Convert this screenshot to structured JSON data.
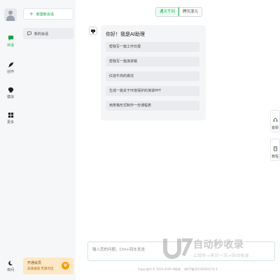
{
  "rail": {
    "items": [
      {
        "label": "对话",
        "icon": "chat-icon"
      },
      {
        "label": "创作",
        "icon": "feather-icon"
      },
      {
        "label": "模拟",
        "icon": "head-profile-icon"
      },
      {
        "label": "更多",
        "icon": "grid-icon"
      }
    ],
    "night_label": "夜间"
  },
  "panel": {
    "new_chat_label": "新建新会话",
    "conversation_label": "新的会话",
    "vip_title": "开通会员",
    "vip_subtitle": "高速通道 无限对话"
  },
  "tabs": [
    {
      "label": "通义千问",
      "active": true
    },
    {
      "label": "腾讯混元",
      "active": false
    }
  ],
  "welcome": {
    "greeting": "你好！我是AI助理",
    "suggestions": [
      "帮我写一篇工作日报",
      "帮我写一篇演讲稿",
      "红烧牛肉的做法",
      "生成一篇关于环境保护的演讲PPT",
      "用表格形式制作一份课程表"
    ]
  },
  "side_buttons": [
    {
      "label": "客服",
      "icon": "headset-icon"
    },
    {
      "label": "教程",
      "icon": "book-icon"
    }
  ],
  "input": {
    "placeholder": "输入您的问题，Ctrl+回车发送"
  },
  "footer": {
    "copyright": "Copyright © 2024-2026 AI助理　 皖ICP备2023020417号-1"
  },
  "watermark": {
    "text_main": "自动秒收录",
    "text_sub": "上线秒→来访一次→自动收录"
  },
  "colors": {
    "accent": "#16a34a",
    "vip_bg": "#fde7c4",
    "vip_coin": "#f59e0b"
  }
}
